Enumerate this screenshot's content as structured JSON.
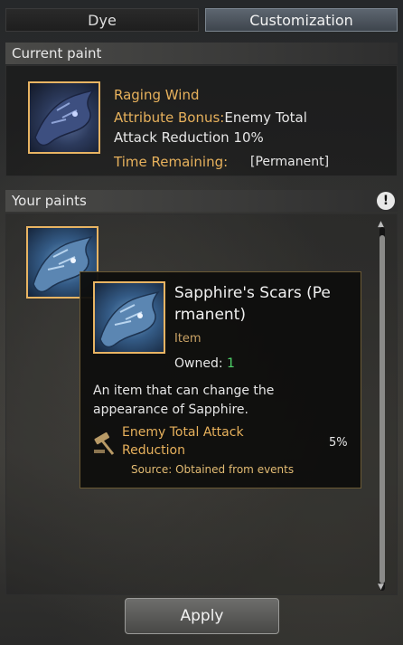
{
  "tabs": {
    "dye": "Dye",
    "customization": "Customization"
  },
  "current_paint": {
    "header": "Current paint",
    "name": "Raging Wind",
    "bonus_label": "Attribute Bonus:",
    "bonus_value": "Enemy Total",
    "bonus_line2": "Attack Reduction 10%",
    "time_label": "Time Remaining:",
    "time_value": "[Permanent]"
  },
  "your_paints": {
    "header": "Your paints",
    "info_icon": "!"
  },
  "tooltip": {
    "title_line1": "Sapphire's Scars (Pe",
    "title_line2": "rmanent)",
    "type": "Item",
    "owned_label": "Owned:",
    "owned_value": "1",
    "desc_line1": "An item that can change the",
    "desc_line2": "appearance of Sapphire.",
    "bonus_name_line1": "Enemy Total Attack",
    "bonus_name_line2": "Reduction",
    "bonus_value": "5%",
    "source": "Source: Obtained from events",
    "bonus_icon": "hammer-icon"
  },
  "buttons": {
    "apply": "Apply"
  },
  "colors": {
    "accent_gold": "#e7b15c",
    "owned_green": "#4fd36a",
    "frame_gold": "#e8b463"
  }
}
